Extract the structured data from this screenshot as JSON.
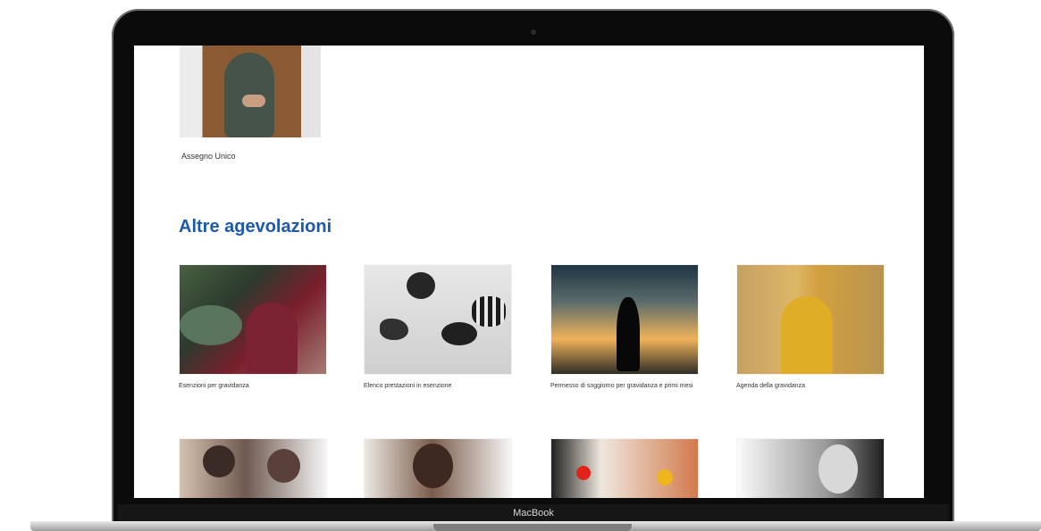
{
  "device": {
    "brand_label": "MacBook"
  },
  "page": {
    "top_caption": "Assegno Unico",
    "section_title": "Altre agevolazioni",
    "cards": [
      {
        "caption": "Esenzioni per gravidanza"
      },
      {
        "caption": "Elenco prestazioni in esenzione"
      },
      {
        "caption": "Permesso di soggiorno per gravidanza e primi mesi"
      },
      {
        "caption": "Agenda della gravidanza"
      }
    ]
  }
}
